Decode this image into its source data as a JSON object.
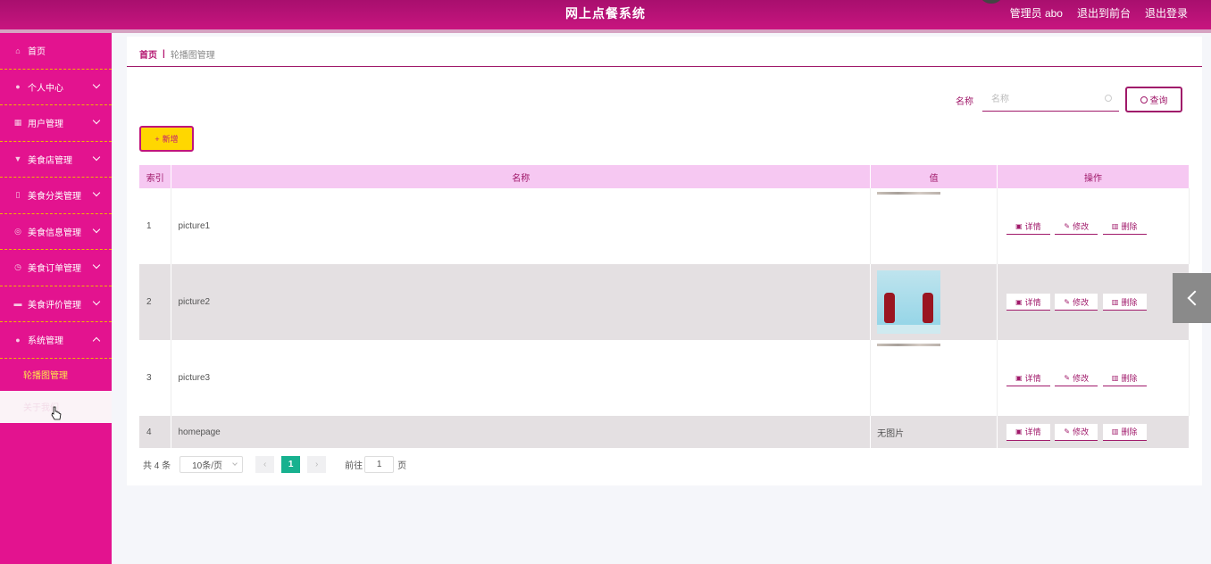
{
  "header": {
    "title": "网上点餐系统",
    "user": "管理员 abo",
    "to_front": "退出到前台",
    "logout": "退出登录"
  },
  "sidebar": {
    "items": [
      {
        "label": "首页",
        "icon": "home-icon"
      },
      {
        "label": "个人中心",
        "icon": "user-icon"
      },
      {
        "label": "用户管理",
        "icon": "grid-icon"
      },
      {
        "label": "美食店管理",
        "icon": "shop-icon"
      },
      {
        "label": "美食分类管理",
        "icon": "category-icon"
      },
      {
        "label": "美食信息管理",
        "icon": "info-icon"
      },
      {
        "label": "美食订单管理",
        "icon": "order-icon"
      },
      {
        "label": "美食评价管理",
        "icon": "review-icon"
      },
      {
        "label": "系统管理",
        "icon": "settings-icon"
      }
    ],
    "sub_items": [
      {
        "label": "轮播图管理"
      },
      {
        "label": "关于我们"
      }
    ]
  },
  "breadcrumb": {
    "home": "首页",
    "separator": "|",
    "current": "轮播图管理"
  },
  "search": {
    "label": "名称",
    "placeholder": "名称",
    "button": "查询"
  },
  "toolbar": {
    "add_label": "新增"
  },
  "table": {
    "headers": [
      "索引",
      "名称",
      "值",
      "操作"
    ],
    "rows": [
      {
        "index": "1",
        "name": "picture1",
        "value": ""
      },
      {
        "index": "2",
        "name": "picture2",
        "value": ""
      },
      {
        "index": "3",
        "name": "picture3",
        "value": ""
      },
      {
        "index": "4",
        "name": "homepage",
        "value": "无图片"
      }
    ],
    "actions": {
      "detail": "详情",
      "edit": "修改",
      "delete": "删除"
    }
  },
  "pagination": {
    "total": "共 4 条",
    "page_size": "10条/页",
    "current_page": "1",
    "goto_label": "前往",
    "goto_value": "1",
    "page_suffix": "页"
  },
  "colors": {
    "header": "#c8157f",
    "sidebar": "#e3138f",
    "accent": "#a0196a",
    "table_header": "#f6c8f2",
    "add_button": "#ffd700",
    "active_page": "#17b18f"
  }
}
